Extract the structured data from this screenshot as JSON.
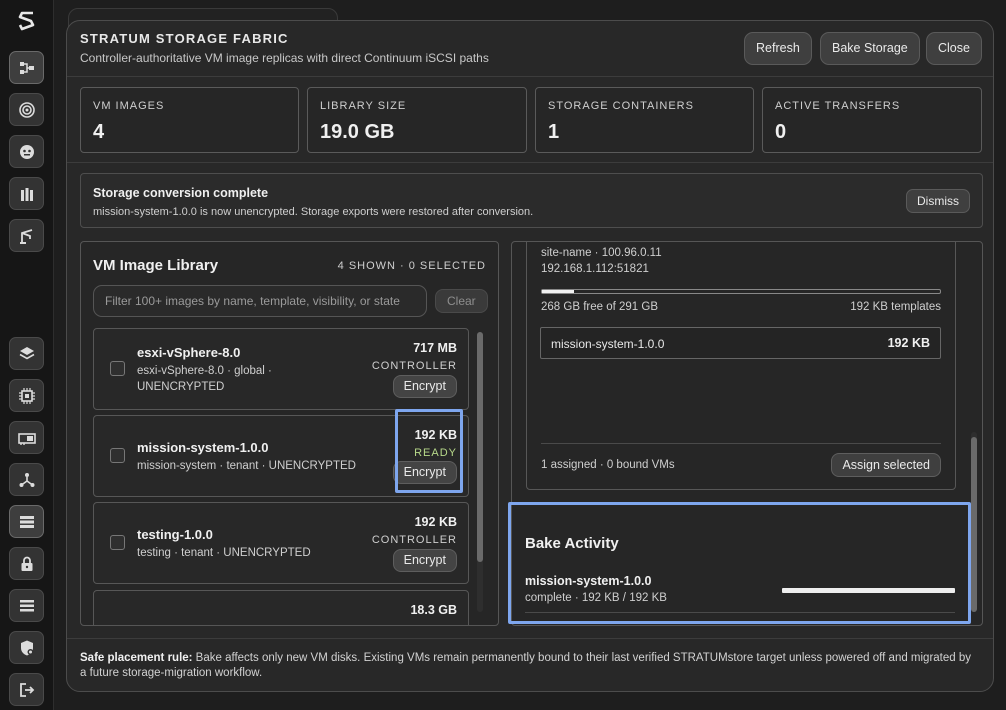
{
  "rail": {
    "icons": [
      "logo-icon",
      "topology-icon",
      "target-icon",
      "robot-icon",
      "bottles-icon",
      "crane-icon",
      "layers-icon",
      "cpu-icon",
      "network-card-icon",
      "hierarchy-icon",
      "storage-list-icon",
      "lock-icon",
      "list-icon",
      "shield-settings-icon",
      "logout-icon"
    ]
  },
  "modal": {
    "title": "STRATUM STORAGE FABRIC",
    "subtitle": "Controller-authoritative VM image replicas with direct Continuum iSCSI paths",
    "buttons": {
      "refresh": "Refresh",
      "bake": "Bake Storage",
      "close": "Close"
    }
  },
  "stats": [
    {
      "label": "VM IMAGES",
      "value": "4"
    },
    {
      "label": "LIBRARY SIZE",
      "value": "19.0 GB"
    },
    {
      "label": "STORAGE CONTAINERS",
      "value": "1"
    },
    {
      "label": "ACTIVE TRANSFERS",
      "value": "0"
    }
  ],
  "alert": {
    "title": "Storage conversion complete",
    "message": "mission-system-1.0.0 is now unencrypted. Storage exports were restored after conversion.",
    "dismiss": "Dismiss"
  },
  "library": {
    "title": "VM Image Library",
    "count": "4 SHOWN · 0 SELECTED",
    "filter_placeholder": "Filter 100+ images by name, template, visibility, or state",
    "clear": "Clear",
    "images": [
      {
        "name": "esxi-vSphere-8.0",
        "meta1": "esxi-vSphere-8.0 · global ·",
        "meta2": "UNENCRYPTED",
        "size": "717 MB",
        "status": "CONTROLLER",
        "action": "Encrypt"
      },
      {
        "name": "mission-system-1.0.0",
        "meta1": "mission-system · tenant · UNENCRYPTED",
        "meta2": "",
        "size": "192 KB",
        "status": "READY",
        "action": "Encrypt"
      },
      {
        "name": "testing-1.0.0",
        "meta1": "testing · tenant · UNENCRYPTED",
        "meta2": "",
        "size": "192 KB",
        "status": "CONTROLLER",
        "action": "Encrypt"
      },
      {
        "name": "",
        "meta1": "",
        "meta2": "",
        "size": "18.3 GB",
        "status": "",
        "action": ""
      }
    ]
  },
  "storage": {
    "site_line": "site-name · 100.96.0.11",
    "address": "192.168.1.112:51821",
    "free": "268 GB free of 291 GB",
    "templates": "192 KB templates",
    "used_fraction": 0.08,
    "assigned": {
      "name": "mission-system-1.0.0",
      "size": "192 KB"
    },
    "footer": "1 assigned · 0 bound VMs",
    "assign_button": "Assign selected"
  },
  "bake": {
    "title": "Bake Activity",
    "name": "mission-system-1.0.0",
    "meta": "complete · 192 KB / 192 KB",
    "progress": 1.0
  },
  "footer": {
    "label": "Safe placement rule:",
    "text": " Bake affects only new VM disks. Existing VMs remain permanently bound to their last verified STRATUMstore target unless powered off and migrated by a future storage-migration workflow."
  },
  "colors": {
    "highlight": "#7ea6ee",
    "ready": "#b7d98a"
  }
}
